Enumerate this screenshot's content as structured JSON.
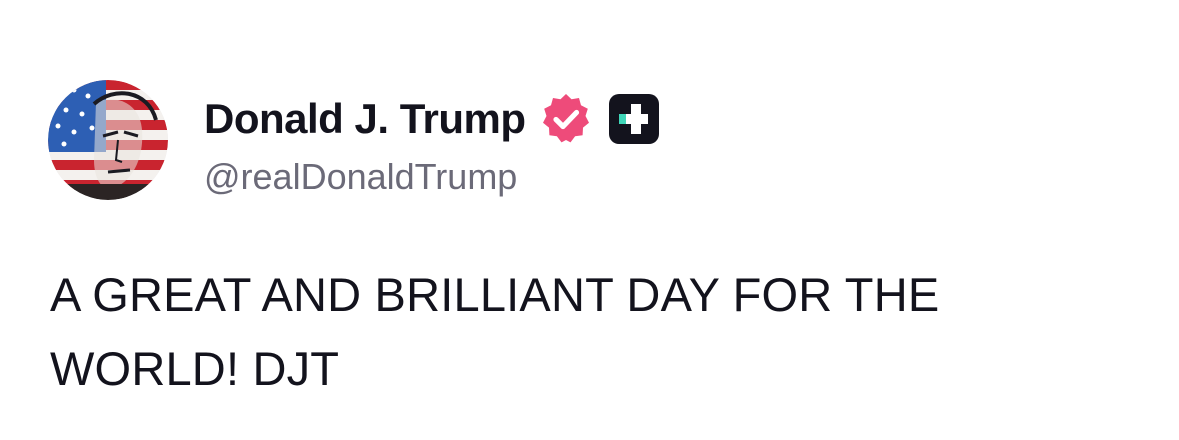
{
  "post": {
    "author": {
      "display_name": "Donald J. Trump",
      "handle": "@realDonaldTrump",
      "verified_icon": "verified-check-icon",
      "verified_color": "#ee4b7a",
      "badge_icon": "plus-badge-icon",
      "badge_color": "#13131d",
      "badge_accent": "#3fd6b8"
    },
    "text": "A GREAT AND BRILLIANT DAY FOR THE WORLD! DJT"
  },
  "colors": {
    "text": "#13131d",
    "handle": "#6b6a78",
    "background": "#ffffff"
  }
}
